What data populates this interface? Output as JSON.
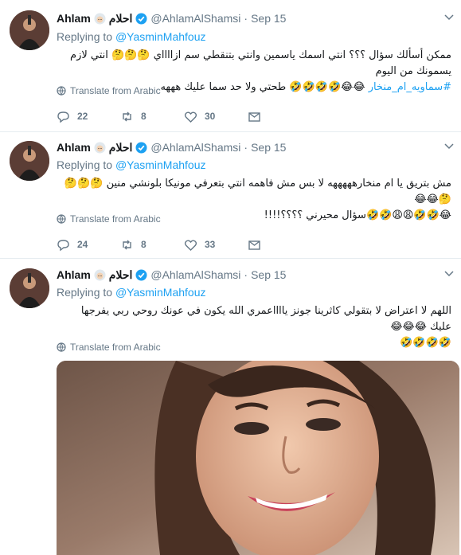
{
  "tweets": [
    {
      "author_name": "Ahlam",
      "author_arabic_name": "احلام",
      "handle": "@AhlamAlShamsi",
      "separator": "·",
      "date": "Sep 15",
      "replying_prefix": "Replying to",
      "replying_mention": "@YasminMahfouz",
      "text_line1": "ممكن أسألك سؤال ؟؟؟ انتي اسمك ياسمين وانتي بتنقطي سم ازااااي 🤔🤔🤔 انتي لازم يسمونك من اليوم",
      "text_line2_hashtag": "#سماويه_ام_منخار",
      "text_line2": "😂😂🤣🤣🤣🤣 طحتي ولا حد سما عليك هههه",
      "translate_label": "Translate from Arabic",
      "replies": "22",
      "retweets": "8",
      "likes": "30"
    },
    {
      "author_name": "Ahlam",
      "author_arabic_name": "احلام",
      "handle": "@AhlamAlShamsi",
      "separator": "·",
      "date": "Sep 15",
      "replying_prefix": "Replying to",
      "replying_mention": "@YasminMahfouz",
      "text_line1": "مش بتريق يا ام منخارهههههه لا بس مش فاهمه انتي بتعرفي مونيكا بلونشي منين 🤔🤔🤔🤔😂😂",
      "text_line2": "😂🤣🤣😩😩🤣🤣سؤال محيرني ؟؟؟؟!!!!",
      "translate_label": "Translate from Arabic",
      "replies": "24",
      "retweets": "8",
      "likes": "33"
    },
    {
      "author_name": "Ahlam",
      "author_arabic_name": "احلام",
      "handle": "@AhlamAlShamsi",
      "separator": "·",
      "date": "Sep 15",
      "replying_prefix": "Replying to",
      "replying_mention": "@YasminMahfouz",
      "text_line1": "اللهم لا اعتراض لا بتقولي كاثرينا جونز يااااعمري الله يكون في عونك  روحي ربي يفرجها عليك 😂😂😂",
      "text_line2": "🤣🤣🤣🤣",
      "translate_label": "Translate from Arabic"
    }
  ],
  "icons": [
    "reply-icon",
    "retweet-icon",
    "like-icon",
    "message-icon",
    "globe-icon",
    "verified-icon",
    "caret-down-icon",
    "hijab-emoji-icon"
  ],
  "colors": {
    "link": "#1da1f2",
    "secondary": "#657786",
    "border": "#e6ecf0"
  }
}
